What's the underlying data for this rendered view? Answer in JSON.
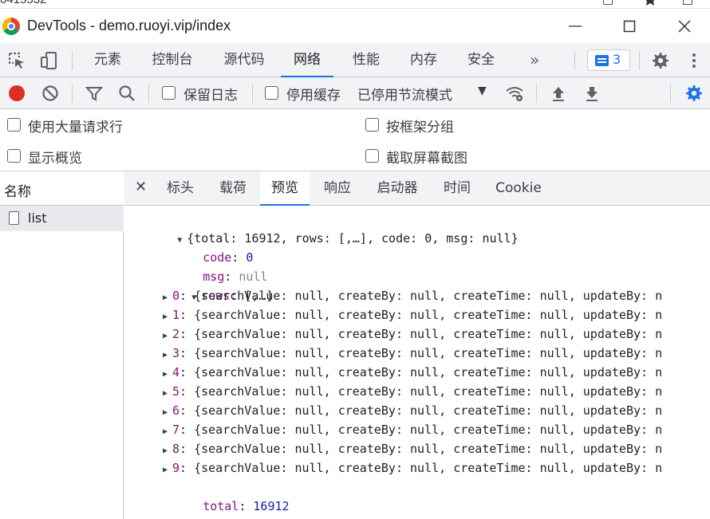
{
  "browser_fragment": "0415532",
  "window": {
    "title": "DevTools - demo.ruoyi.vip/index"
  },
  "devtools_tabs": [
    {
      "label": "元素"
    },
    {
      "label": "控制台"
    },
    {
      "label": "源代码"
    },
    {
      "label": "网络"
    },
    {
      "label": "性能"
    },
    {
      "label": "内存"
    },
    {
      "label": "安全"
    }
  ],
  "more_tabs": "»",
  "issues_count": "3",
  "network_toolbar": {
    "preserve_log": "保留日志",
    "disable_cache": "停用缓存",
    "throttling": "已停用节流模式"
  },
  "options": {
    "large_rows": "使用大量请求行",
    "group_by_frame": "按框架分组",
    "show_overview": "显示概览",
    "capture_screenshots": "截取屏幕截图"
  },
  "request_list": {
    "header": "名称",
    "items": [
      {
        "name": "list"
      }
    ]
  },
  "detail_tabs": [
    {
      "label": "标头"
    },
    {
      "label": "载荷"
    },
    {
      "label": "预览"
    },
    {
      "label": "响应"
    },
    {
      "label": "启动器"
    },
    {
      "label": "时间"
    },
    {
      "label": "Cookie"
    }
  ],
  "preview": {
    "root_summary": "{total: 16912, rows: [,…], code: 0, msg: null}",
    "code_key": "code",
    "code_value": "0",
    "msg_key": "msg",
    "msg_value": "null",
    "rows_key": "rows",
    "rows_summary": "[,…]",
    "row_summary": "{searchValue: null, createBy: null, createTime: null, updateBy: n",
    "row_indices": [
      "0",
      "1",
      "2",
      "3",
      "4",
      "5",
      "6",
      "7",
      "8",
      "9"
    ],
    "total_key": "total",
    "total_value": "16912"
  }
}
